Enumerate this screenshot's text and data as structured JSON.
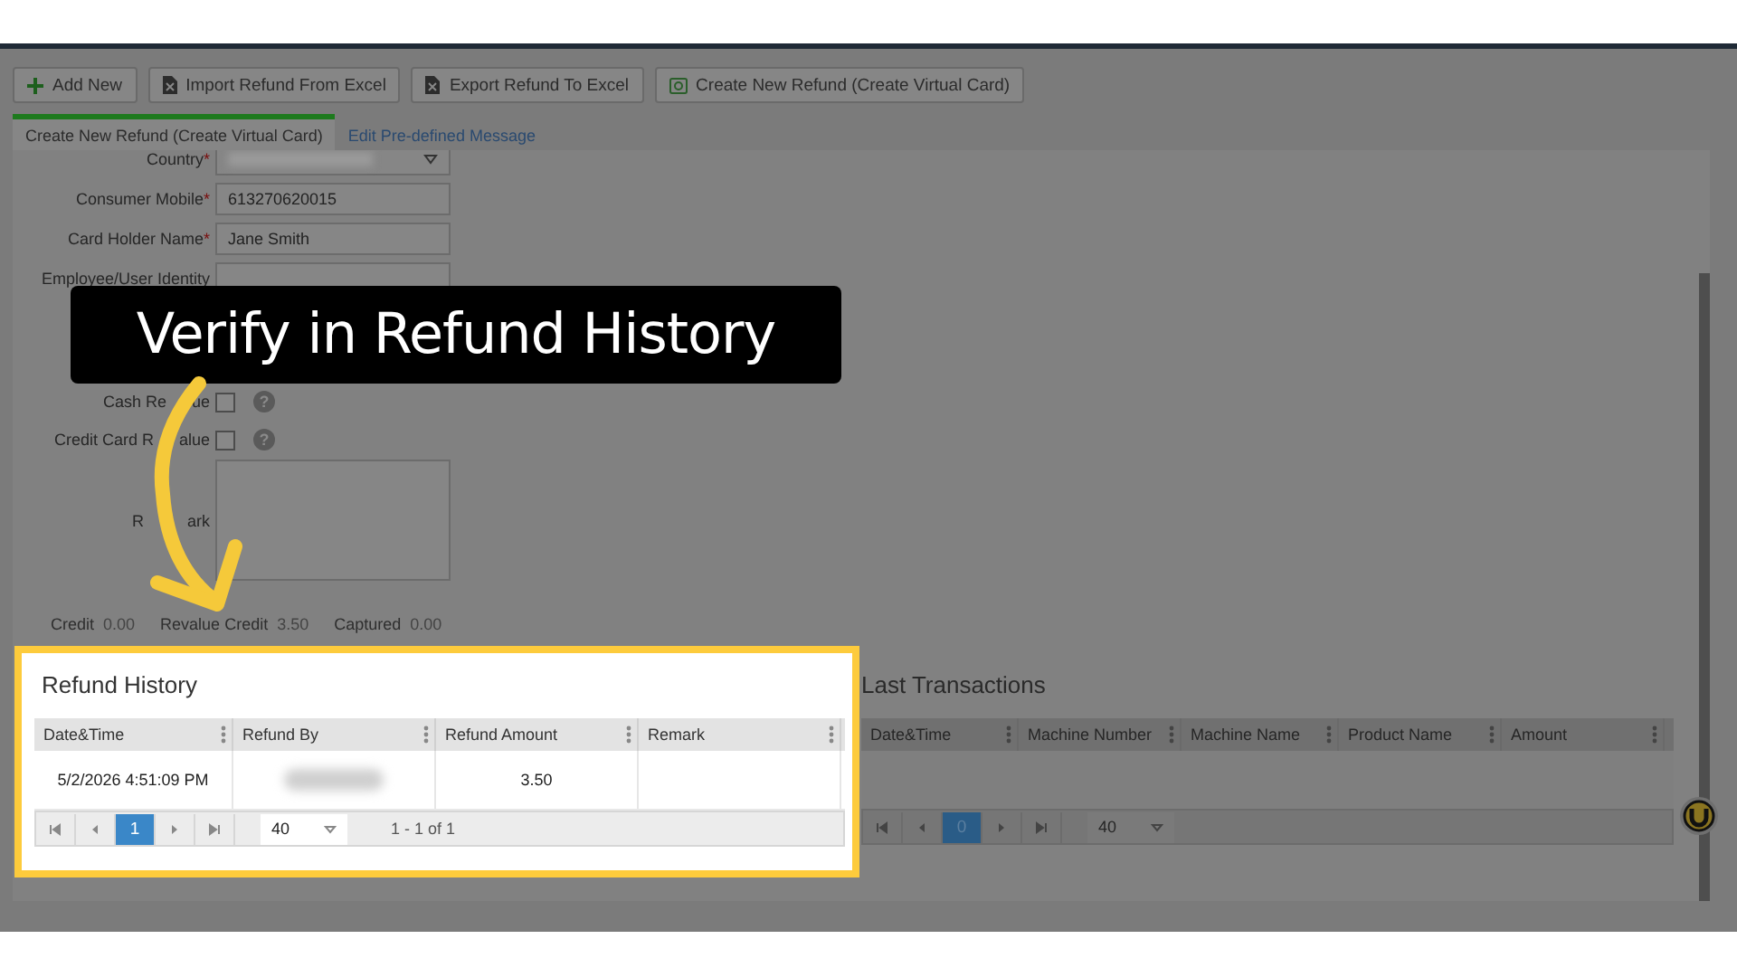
{
  "toolbar": [
    {
      "label": "Add New",
      "kind": "plus"
    },
    {
      "label": "Import Refund From Excel",
      "kind": "file"
    },
    {
      "label": "Export Refund To Excel",
      "kind": "file"
    },
    {
      "label": "Create New Refund (Create Virtual Card)",
      "kind": "card"
    }
  ],
  "tabs": [
    {
      "label": "Create New Refund (Create Virtual Card)",
      "selected": true
    },
    {
      "label": "Edit Pre-defined Message",
      "selected": false
    }
  ],
  "form": {
    "fields": [
      {
        "kind": "select",
        "label": "Country",
        "required_mark": "*",
        "blurred": true
      },
      {
        "kind": "text",
        "label": "Consumer Mobile",
        "required_mark": "*",
        "value": "613270620015"
      },
      {
        "kind": "text",
        "label": "Card Holder Name",
        "required_mark": "*",
        "value": "Jane Smith"
      },
      {
        "kind": "text",
        "label": "Employee/User Identity"
      },
      {
        "kind": "checkbox",
        "label": "Cash Re",
        "label_end": "ue",
        "checked": false,
        "help": "?"
      },
      {
        "kind": "checkbox",
        "label": "Credit Card R",
        "label_end": "alue",
        "checked": false,
        "help": "?"
      },
      {
        "kind": "textarea",
        "label": "R",
        "label_end": "ark"
      }
    ]
  },
  "totals": [
    {
      "label": "Credit",
      "value": "0.00"
    },
    {
      "label": "Revalue Credit",
      "value": "3.50"
    },
    {
      "label": "Captured",
      "value": "0.00"
    }
  ],
  "refund_history": {
    "title": "Refund History",
    "highlighted": true,
    "columns": [
      "Date&Time",
      "Refund By",
      "Refund Amount",
      "Remark"
    ],
    "rows": [
      [
        {
          "kind": "text",
          "text": "5/2/2026 4:51:09 PM"
        },
        {
          "kind": "blurred"
        },
        {
          "kind": "text",
          "text": "3.50"
        },
        {
          "kind": "empty"
        }
      ]
    ],
    "pager": {
      "page": "1",
      "page_size": "40",
      "summary": "1 - 1 of 1"
    }
  },
  "last_transactions": {
    "title": "Last Transactions",
    "highlighted": false,
    "columns": [
      "Date&Time",
      "Machine Number",
      "Machine Name",
      "Product Name",
      "Amount"
    ],
    "pager": {
      "page": "0",
      "page_size": "40"
    }
  },
  "callout": {
    "text": "Verify in Refund History"
  }
}
